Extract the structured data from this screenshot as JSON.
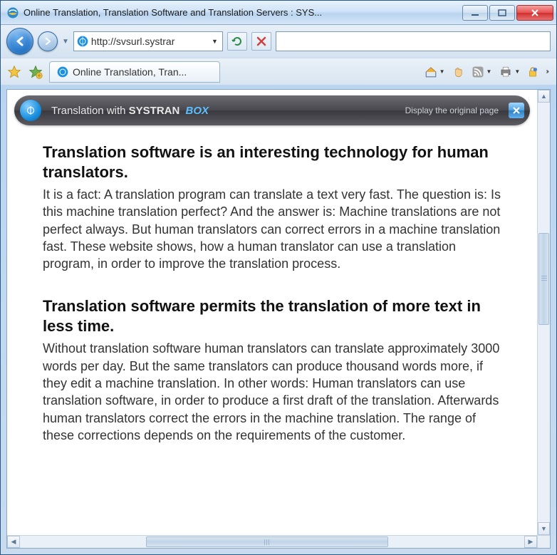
{
  "window": {
    "title": "Online Translation, Translation Software and Translation Servers : SYS..."
  },
  "address": {
    "url": "http://svsurl.systrar"
  },
  "tab": {
    "title": "Online Translation, Tran..."
  },
  "systran": {
    "prefix": "Translation with",
    "brand": "SYSTRAN",
    "product": "BOX",
    "link": "Display the original page"
  },
  "article": {
    "h1": "Translation software is an interesting technology for human translators.",
    "p1": "It is a fact: A translation program can translate a text very fast. The question is: Is this machine translation perfect? And the answer is: Machine translations are not perfect always. But human translators can correct errors in a machine translation fast. These website shows, how a human translator can use a translation program, in order to improve the translation process.",
    "h2": "Translation software permits the translation of more text in less time.",
    "p2": "Without translation software human translators can translate approximately 3000 words per day. But the same translators can produce thousand words more, if they edit a machine translation. In other words: Human translators can use translation software, in order to produce a first draft of the translation. Afterwards human translators correct the errors in the machine translation. The range of these corrections depends on the requirements of the customer."
  }
}
